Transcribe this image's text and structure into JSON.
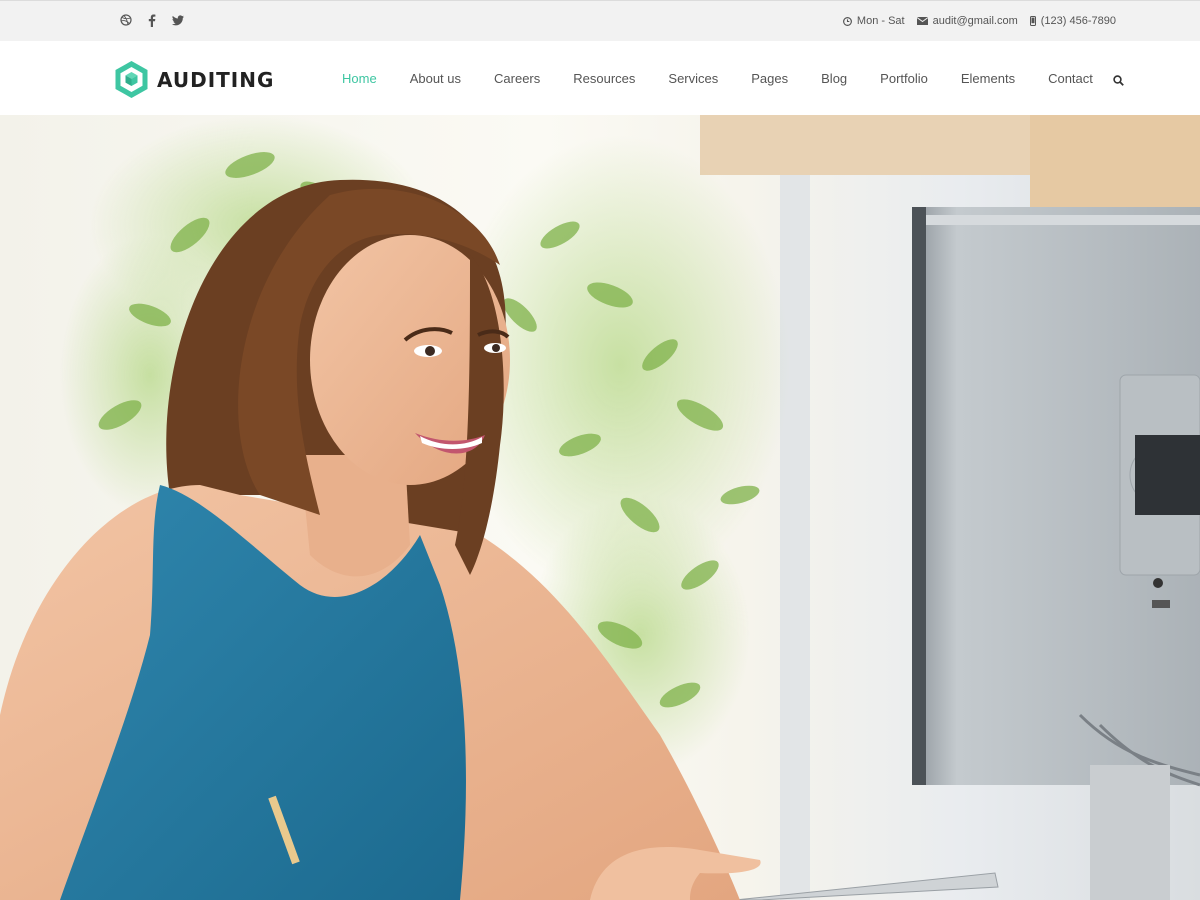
{
  "topbar": {
    "social_icons": [
      "dribbble-icon",
      "facebook-icon",
      "twitter-icon"
    ],
    "hours": "Mon - Sat",
    "email": "audit@gmail.com",
    "phone": "(123) 456-7890"
  },
  "header": {
    "logo_text": "AUDITING",
    "nav": [
      "Home",
      "About us",
      "Careers",
      "Resources",
      "Services",
      "Pages",
      "Blog",
      "Portfolio",
      "Elements",
      "Contact"
    ],
    "active_item": "Home"
  },
  "colors": {
    "accent": "#3ec6a2",
    "topbar_bg": "#f2f2f2",
    "text": "#555555"
  },
  "hero": {
    "image": "woman-at-computer-photo"
  }
}
